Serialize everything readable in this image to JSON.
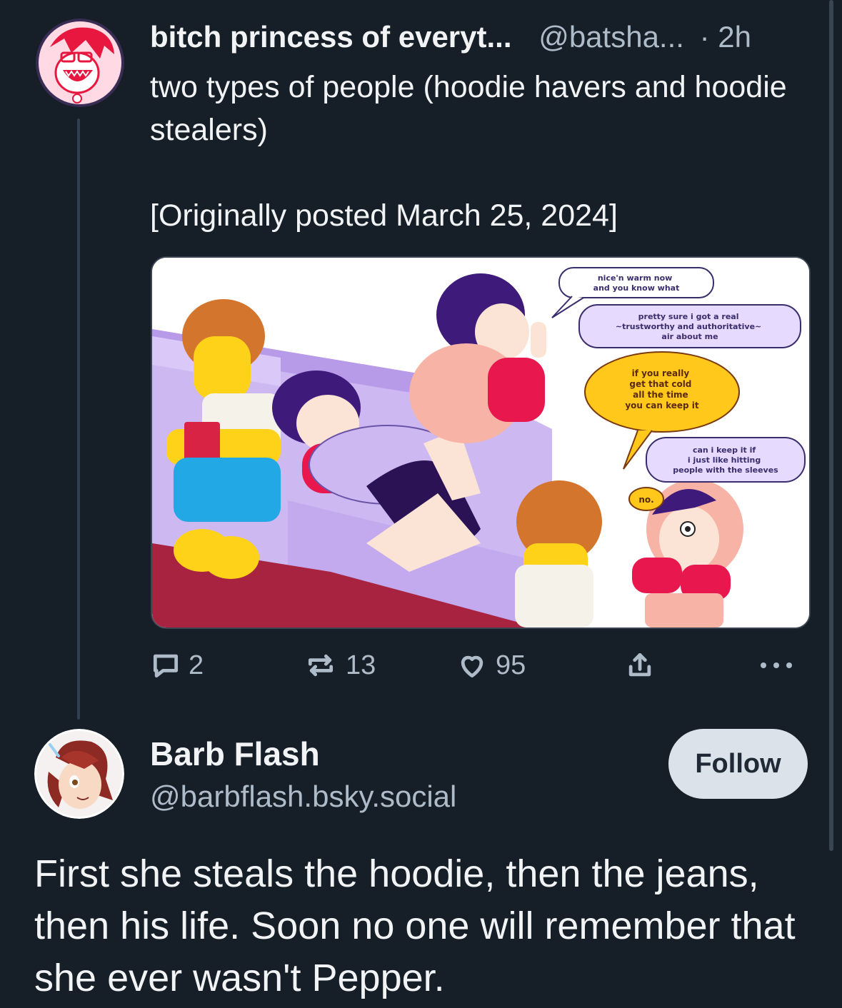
{
  "post": {
    "display_name": "bitch princess of everyt...",
    "handle": "@batsha...",
    "time": "· 2h",
    "text": "two types of people (hoodie havers and hoodie stealers)\n\n[Originally posted March 25, 2024]",
    "comic": {
      "bubble_1": [
        "nice'n warm now",
        "and you know what"
      ],
      "bubble_2": [
        "pretty sure i got a real",
        "~trustworthy and authoritative~",
        "air about me"
      ],
      "bubble_3": [
        "if you really",
        "get that cold",
        "all the time",
        "you can keep it"
      ],
      "bubble_4": [
        "can i keep it if",
        "i just like hitting",
        "people with the sleeves"
      ],
      "bubble_5": "no."
    },
    "actions": {
      "replies": "2",
      "reposts": "13",
      "likes": "95"
    }
  },
  "reply": {
    "display_name": "Barb Flash",
    "handle": "@barbflash.bsky.social",
    "follow_label": "Follow",
    "text": "First she steals the hoodie, then the jeans, then his life. Soon no one will remember that she ever wasn't Pepper."
  },
  "colors": {
    "background": "#161e27",
    "text": "#f1f3f5",
    "muted": "#aebbc9",
    "follow_bg": "#dce2ea"
  },
  "icons": [
    "avatar",
    "reply-icon",
    "repost-icon",
    "like-icon",
    "share-icon",
    "more-icon"
  ]
}
